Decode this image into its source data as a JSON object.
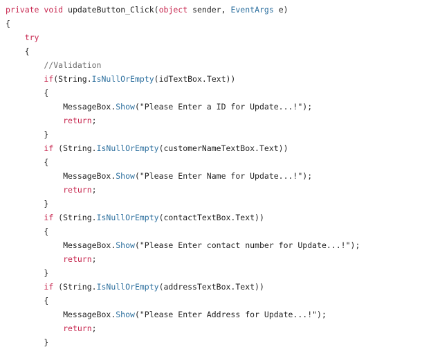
{
  "colors": {
    "background": "#ffffff",
    "keyword": "#c7254e",
    "type": "#2c6f9e",
    "method": "#2c6f9e",
    "comment": "#6a6a6a",
    "plain": "#1f1f1f"
  },
  "code_lines": [
    [
      {
        "t": "private",
        "k": "keyword"
      },
      {
        "t": " ",
        "k": "plain"
      },
      {
        "t": "void",
        "k": "keyword"
      },
      {
        "t": " updateButton_Click(",
        "k": "plain"
      },
      {
        "t": "object",
        "k": "keyword"
      },
      {
        "t": " sender, ",
        "k": "plain"
      },
      {
        "t": "EventArgs",
        "k": "type"
      },
      {
        "t": " e)",
        "k": "plain"
      }
    ],
    [
      {
        "t": "{",
        "k": "plain"
      }
    ],
    [
      {
        "t": "    ",
        "k": "plain"
      },
      {
        "t": "try",
        "k": "keyword"
      }
    ],
    [
      {
        "t": "    {",
        "k": "plain"
      }
    ],
    [
      {
        "t": "        //Validation",
        "k": "comment"
      }
    ],
    [
      {
        "t": "        ",
        "k": "plain"
      },
      {
        "t": "if",
        "k": "keyword"
      },
      {
        "t": "(String.",
        "k": "plain"
      },
      {
        "t": "IsNullOrEmpty",
        "k": "method"
      },
      {
        "t": "(idTextBox.Text))",
        "k": "plain"
      }
    ],
    [
      {
        "t": "        {",
        "k": "plain"
      }
    ],
    [
      {
        "t": "            MessageBox.",
        "k": "plain"
      },
      {
        "t": "Show",
        "k": "method"
      },
      {
        "t": "(\"Please Enter a ID for Update...!\");",
        "k": "plain"
      }
    ],
    [
      {
        "t": "            ",
        "k": "plain"
      },
      {
        "t": "return",
        "k": "keyword"
      },
      {
        "t": ";",
        "k": "plain"
      }
    ],
    [
      {
        "t": "        }",
        "k": "plain"
      }
    ],
    [
      {
        "t": "        ",
        "k": "plain"
      },
      {
        "t": "if",
        "k": "keyword"
      },
      {
        "t": " (String.",
        "k": "plain"
      },
      {
        "t": "IsNullOrEmpty",
        "k": "method"
      },
      {
        "t": "(customerNameTextBox.Text))",
        "k": "plain"
      }
    ],
    [
      {
        "t": "        {",
        "k": "plain"
      }
    ],
    [
      {
        "t": "            MessageBox.",
        "k": "plain"
      },
      {
        "t": "Show",
        "k": "method"
      },
      {
        "t": "(\"Please Enter Name for Update...!\");",
        "k": "plain"
      }
    ],
    [
      {
        "t": "            ",
        "k": "plain"
      },
      {
        "t": "return",
        "k": "keyword"
      },
      {
        "t": ";",
        "k": "plain"
      }
    ],
    [
      {
        "t": "        }",
        "k": "plain"
      }
    ],
    [
      {
        "t": "        ",
        "k": "plain"
      },
      {
        "t": "if",
        "k": "keyword"
      },
      {
        "t": " (String.",
        "k": "plain"
      },
      {
        "t": "IsNullOrEmpty",
        "k": "method"
      },
      {
        "t": "(contactTextBox.Text))",
        "k": "plain"
      }
    ],
    [
      {
        "t": "        {",
        "k": "plain"
      }
    ],
    [
      {
        "t": "            MessageBox.",
        "k": "plain"
      },
      {
        "t": "Show",
        "k": "method"
      },
      {
        "t": "(\"Please Enter contact number for Update...!\");",
        "k": "plain"
      }
    ],
    [
      {
        "t": "            ",
        "k": "plain"
      },
      {
        "t": "return",
        "k": "keyword"
      },
      {
        "t": ";",
        "k": "plain"
      }
    ],
    [
      {
        "t": "        }",
        "k": "plain"
      }
    ],
    [
      {
        "t": "        ",
        "k": "plain"
      },
      {
        "t": "if",
        "k": "keyword"
      },
      {
        "t": " (String.",
        "k": "plain"
      },
      {
        "t": "IsNullOrEmpty",
        "k": "method"
      },
      {
        "t": "(addressTextBox.Text))",
        "k": "plain"
      }
    ],
    [
      {
        "t": "        {",
        "k": "plain"
      }
    ],
    [
      {
        "t": "            MessageBox.",
        "k": "plain"
      },
      {
        "t": "Show",
        "k": "method"
      },
      {
        "t": "(\"Please Enter Address for Update...!\");",
        "k": "plain"
      }
    ],
    [
      {
        "t": "            ",
        "k": "plain"
      },
      {
        "t": "return",
        "k": "keyword"
      },
      {
        "t": ";",
        "k": "plain"
      }
    ],
    [
      {
        "t": "        }",
        "k": "plain"
      }
    ]
  ]
}
